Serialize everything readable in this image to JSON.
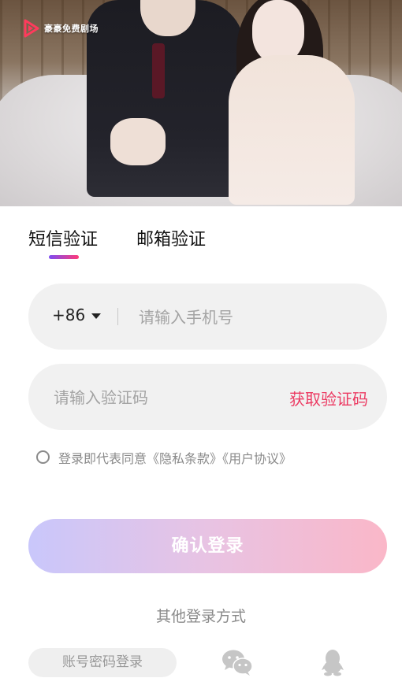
{
  "app": {
    "name": "豪豪免费剧场",
    "accent_color": "#ec3a62",
    "gradient_colors": [
      "#7d4cf2",
      "#ff3a77"
    ]
  },
  "hero": {
    "logo_icon": "play-triangle-icon"
  },
  "tabs": [
    {
      "label": "短信验证",
      "active": true
    },
    {
      "label": "邮箱验证",
      "active": false
    }
  ],
  "phone": {
    "country_code": "+86",
    "value": "",
    "placeholder": "请输入手机号"
  },
  "code": {
    "value": "",
    "placeholder": "请输入验证码",
    "get_code_label": "获取验证码"
  },
  "agreement": {
    "checked": false,
    "text": "登录即代表同意《隐私条款》《用户协议》"
  },
  "confirm": {
    "label": "确认登录"
  },
  "other_login": {
    "title": "其他登录方式",
    "account_label": "账号密码登录",
    "icons": [
      "wechat-icon",
      "qq-icon"
    ]
  }
}
